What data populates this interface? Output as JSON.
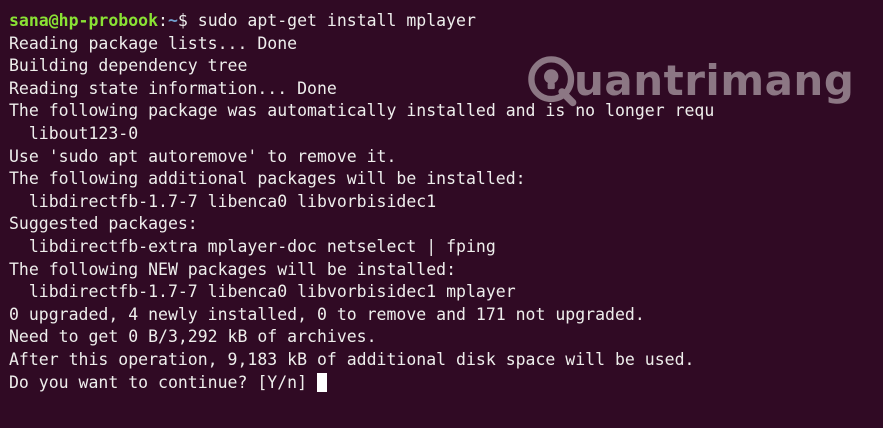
{
  "prompt": {
    "user_host": "sana@hp-probook",
    "path": "~",
    "symbol": "$ ",
    "command": "sudo apt-get install mplayer"
  },
  "output_lines": [
    "Reading package lists... Done",
    "Building dependency tree",
    "Reading state information... Done",
    "The following package was automatically installed and is no longer requ",
    "  libout123-0",
    "Use 'sudo apt autoremove' to remove it.",
    "The following additional packages will be installed:",
    "  libdirectfb-1.7-7 libenca0 libvorbisidec1",
    "Suggested packages:",
    "  libdirectfb-extra mplayer-doc netselect | fping",
    "The following NEW packages will be installed:",
    "  libdirectfb-1.7-7 libenca0 libvorbisidec1 mplayer",
    "0 upgraded, 4 newly installed, 0 to remove and 171 not upgraded.",
    "Need to get 0 B/3,292 kB of archives.",
    "After this operation, 9,183 kB of additional disk space will be used."
  ],
  "confirm_prompt": "Do you want to continue? [Y/n]",
  "watermark": {
    "text": "uantrimang",
    "logo_icon": "lightbulb-q-icon"
  },
  "colors": {
    "background": "#300a24",
    "text": "#eeeeec",
    "user_host": "#8ae234",
    "path": "#729fcf"
  }
}
